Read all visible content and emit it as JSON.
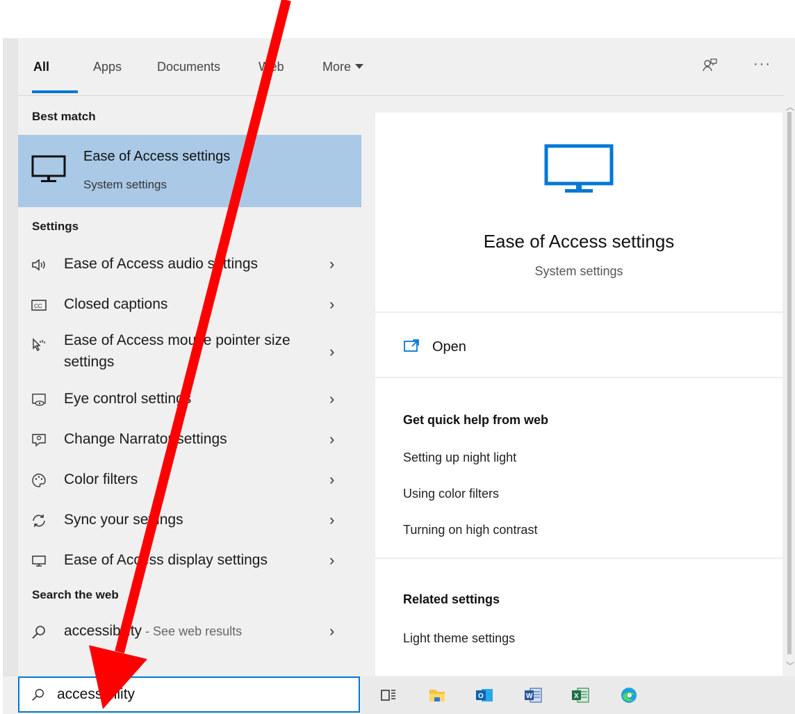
{
  "tabs": [
    {
      "label": "All",
      "active": true
    },
    {
      "label": "Apps"
    },
    {
      "label": "Documents"
    },
    {
      "label": "Web"
    },
    {
      "label": "More"
    }
  ],
  "icons_top": [
    "feedback-icon",
    "more-options-icon"
  ],
  "best_match": {
    "heading": "Best match",
    "title": "Ease of Access settings",
    "subtitle": "System settings",
    "icon": "monitor-icon"
  },
  "settings": {
    "heading": "Settings",
    "items": [
      {
        "label": "Ease of Access audio settings",
        "icon": "speaker-icon"
      },
      {
        "label": "Closed captions",
        "icon": "cc-icon"
      },
      {
        "label": "Ease of Access mouse pointer size settings",
        "icon": "pointer-icon"
      },
      {
        "label": "Eye control settings",
        "icon": "eye-control-icon"
      },
      {
        "label": "Change Narrator settings",
        "icon": "narrator-icon"
      },
      {
        "label": "Color filters",
        "icon": "palette-icon"
      },
      {
        "label": "Sync your settings",
        "icon": "sync-icon"
      },
      {
        "label": "Ease of Access display settings",
        "icon": "display-icon"
      }
    ]
  },
  "web_search": {
    "heading": "Search the web",
    "query": "accessibility",
    "suffix": " - See web results"
  },
  "search_box": {
    "value": "accessibility"
  },
  "preview": {
    "title": "Ease of Access settings",
    "subtitle": "System settings",
    "open_label": "Open",
    "quick_help_heading": "Get quick help from web",
    "quick_help_links": [
      "Setting up night light",
      "Using color filters",
      "Turning on high contrast"
    ],
    "related_heading": "Related settings",
    "related_links": [
      "Light theme settings"
    ]
  },
  "taskbar": [
    "task-view-icon",
    "file-explorer-icon",
    "outlook-icon",
    "word-icon",
    "excel-icon",
    "edge-icon"
  ],
  "colors": {
    "accent": "#0078d4",
    "selected": "#a9c9e6",
    "annotation": "#ff0000"
  }
}
